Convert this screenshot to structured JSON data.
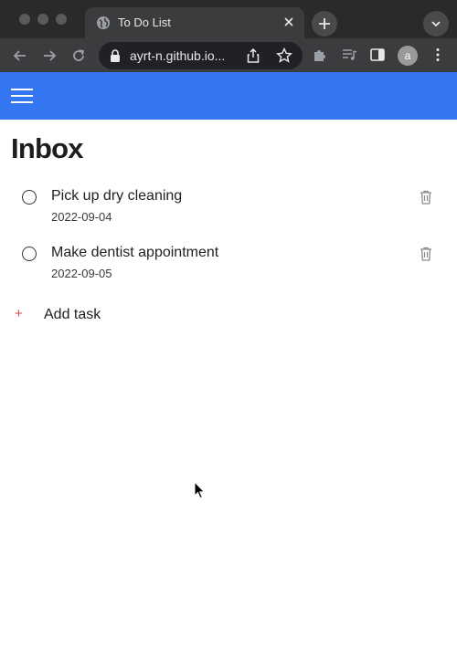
{
  "browser": {
    "tab_title": "To Do List",
    "url": "ayrt-n.github.io...",
    "avatar_letter": "a"
  },
  "app": {
    "accent_color": "#3577f2",
    "page_title": "Inbox",
    "tasks": [
      {
        "title": "Pick up dry cleaning",
        "date": "2022-09-04"
      },
      {
        "title": "Make dentist appointment",
        "date": "2022-09-05"
      }
    ],
    "add_task_icon": "+",
    "add_task_label": "Add task"
  }
}
